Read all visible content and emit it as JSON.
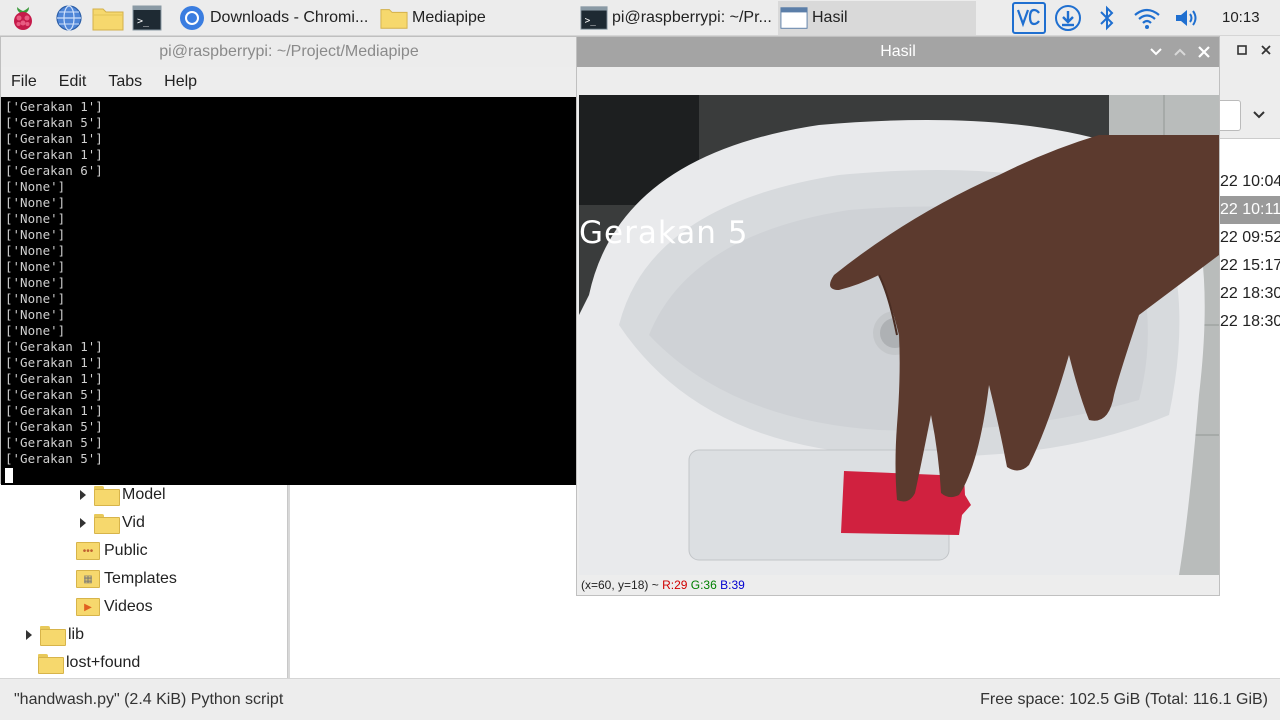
{
  "taskbar": {
    "launchers": [
      "raspberry-menu",
      "web-browser",
      "file-manager",
      "terminal"
    ],
    "tasks": [
      {
        "label": "Downloads - Chromi..."
      },
      {
        "label": "Mediapipe"
      },
      {
        "label": "pi@raspberrypi: ~/Pr..."
      },
      {
        "label": "Hasil"
      }
    ],
    "clock": "10:13"
  },
  "terminal": {
    "title": "pi@raspberrypi: ~/Project/Mediapipe",
    "menu": [
      "File",
      "Edit",
      "Tabs",
      "Help"
    ],
    "lines": [
      "['Gerakan 1']",
      "['Gerakan 5']",
      "['Gerakan 1']",
      "['Gerakan 1']",
      "['Gerakan 6']",
      "['None']",
      "['None']",
      "['None']",
      "['None']",
      "['None']",
      "['None']",
      "['None']",
      "['None']",
      "['None']",
      "['None']",
      "['Gerakan 1']",
      "['Gerakan 1']",
      "['Gerakan 1']",
      "['Gerakan 5']",
      "['Gerakan 1']",
      "['Gerakan 5']",
      "['Gerakan 5']",
      "['Gerakan 5']"
    ]
  },
  "hasil": {
    "title": "Hasil",
    "overlay_text": "Gerakan 5",
    "pixel_info": {
      "coords": "(x=60, y=18) ~",
      "r": "R:29",
      "g": "G:36",
      "b": "B:39"
    }
  },
  "file_manager": {
    "tree": [
      {
        "label": "Model",
        "expandable": true
      },
      {
        "label": "Vid",
        "expandable": true
      },
      {
        "label": "Public",
        "expandable": false
      },
      {
        "label": "Templates",
        "expandable": false
      },
      {
        "label": "Videos",
        "expandable": false
      },
      {
        "label": "lib",
        "expandable": true
      },
      {
        "label": "lost+found",
        "expandable": false
      }
    ],
    "dates": [
      "22 10:04",
      "22 10:11",
      "22 09:52",
      "22 15:17",
      "22 18:30",
      "22 18:30"
    ],
    "status_left": "\"handwash.py\" (2.4 KiB) Python script",
    "status_right": "Free space: 102.5 GiB (Total: 116.1 GiB)"
  }
}
